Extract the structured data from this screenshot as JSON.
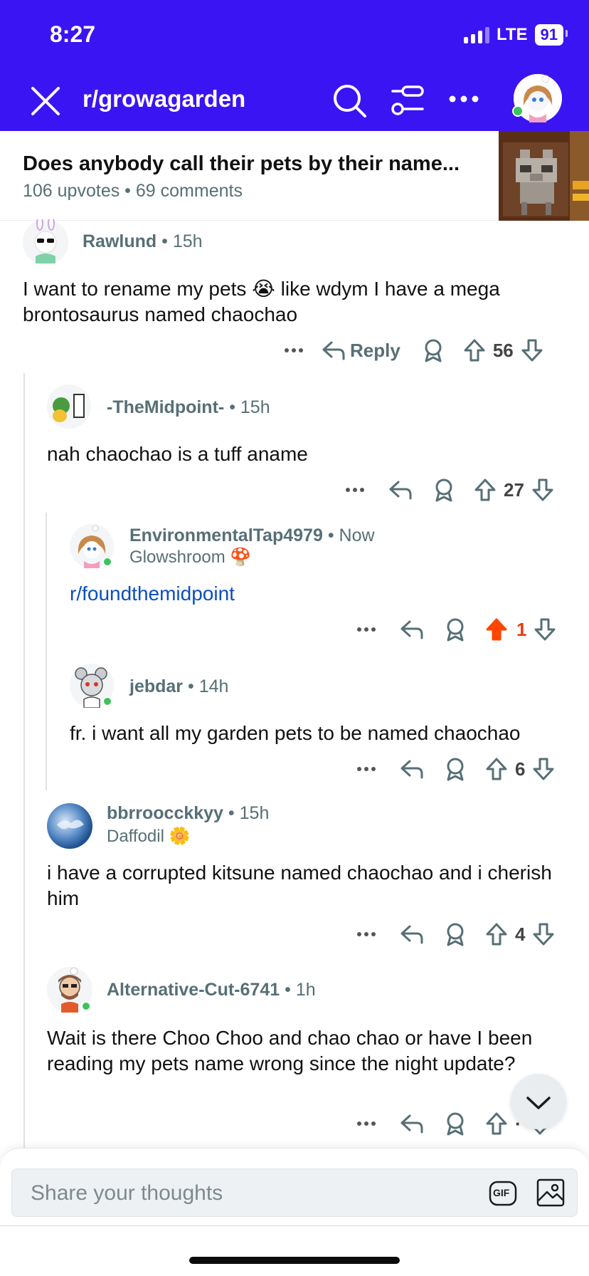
{
  "status_bar": {
    "time": "8:27",
    "network": "LTE",
    "battery": "91"
  },
  "nav": {
    "title": "r/growagarden"
  },
  "post": {
    "title": "Does anybody call their pets by their name...",
    "upvotes": "106 upvotes",
    "separator": "•",
    "comments": "69 comments"
  },
  "comments": [
    {
      "username": "Rawlund",
      "time": "15h",
      "body": "I want to rename my pets 😭 like wdym I have a mega brontosaurus named chaochao",
      "reply_label": "Reply",
      "score": "56"
    },
    {
      "username": "-TheMidpoint-",
      "time": "15h",
      "body": "nah chaochao is a tuff aname",
      "score": "27"
    },
    {
      "username": "EnvironmentalTap4979",
      "time": "Now",
      "flair": "Glowshroom 🍄",
      "body": "r/foundthemidpoint",
      "score": "1",
      "upvoted": true
    },
    {
      "username": "jebdar",
      "time": "14h",
      "body": "fr. i want all my garden pets to be named chaochao",
      "score": "6"
    },
    {
      "username": "bbrroocckkyy",
      "time": "15h",
      "flair": "Daffodil 🌼",
      "body": "i have a corrupted kitsune named chaochao and i cherish him",
      "score": "4"
    },
    {
      "username": "Alternative-Cut-6741",
      "time": "1h",
      "body": "Wait is there Choo Choo and chao chao or have I been reading my pets name wrong since the night update?",
      "score": "·"
    }
  ],
  "composer": {
    "placeholder": "Share your thoughts",
    "gif_label": "GIF"
  },
  "icons": {
    "close": "close-icon",
    "search": "search-icon",
    "filter": "filter-icon",
    "more": "more-icon",
    "reply": "reply-icon",
    "award": "award-icon",
    "upvote": "upvote-icon",
    "downvote": "downvote-icon",
    "scroll_down": "chevron-down-icon",
    "gif": "gif-icon",
    "image": "image-icon"
  },
  "colors": {
    "header": "#3a14f2",
    "meta": "#576f76",
    "link": "#0b4ec2",
    "upvoted": "#e53d0f",
    "online": "#3cc35b"
  }
}
